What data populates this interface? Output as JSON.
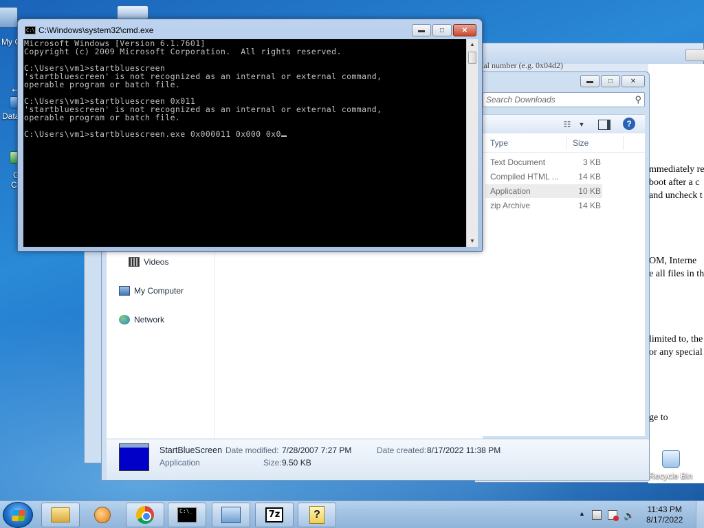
{
  "desktop": {
    "icons": [
      {
        "label": "My C"
      },
      {
        "label": "Data"
      },
      {
        "label": "G"
      },
      {
        "label": "C"
      }
    ],
    "recycle_bin_label": "Recycle Bin"
  },
  "doc_window": {
    "lines": [
      "ial number (e.g. 0x04d2)",
      "mmediately re",
      "boot after a c",
      "and uncheck t",
      "OM, Interne",
      "e all files in th",
      "limited to, the",
      "or any special",
      "ge to"
    ]
  },
  "explorer": {
    "search_placeholder": "Search Downloads",
    "columns": {
      "type": "Type",
      "size": "Size"
    },
    "files": [
      {
        "type": "Text Document",
        "size": "3 KB",
        "selected": false
      },
      {
        "type": "Compiled HTML ...",
        "size": "14 KB",
        "selected": false
      },
      {
        "type": "Application",
        "size": "10 KB",
        "selected": true
      },
      {
        "type": "zip Archive",
        "size": "14 KB",
        "selected": false
      }
    ],
    "nav": {
      "videos": "Videos",
      "computer": "My Computer",
      "network": "Network"
    },
    "details": {
      "name": "StartBlueScreen",
      "kind": "Application",
      "modified_label": "Date modified:",
      "modified_value": "7/28/2007 7:27 PM",
      "created_label": "Date created:",
      "created_value": "8/17/2022 11:38 PM",
      "size_label": "Size:",
      "size_value": "9.50 KB"
    }
  },
  "cmd": {
    "title": "C:\\Windows\\system32\\cmd.exe",
    "lines": [
      "Microsoft Windows [Version 6.1.7601]",
      "Copyright (c) 2009 Microsoft Corporation.  All rights reserved.",
      "",
      "C:\\Users\\vm1>startbluescreen",
      "'startbluescreen' is not recognized as an internal or external command,",
      "operable program or batch file.",
      "",
      "C:\\Users\\vm1>startbluescreen 0x011",
      "'startbluescreen' is not recognized as an internal or external command,",
      "operable program or batch file.",
      "",
      "C:\\Users\\vm1>startbluescreen.exe 0x000011 0x000 0x0"
    ]
  },
  "taskbar": {
    "apps": [
      "explorer",
      "media-player",
      "chrome",
      "cmd",
      "remote-desktop",
      "7-zip",
      "help"
    ],
    "tray": {
      "time": "11:43 PM",
      "date": "8/17/2022"
    }
  },
  "icon_labels": {
    "sevenzip": "7z",
    "help": "?",
    "cmd_mini": "C:\\_"
  }
}
